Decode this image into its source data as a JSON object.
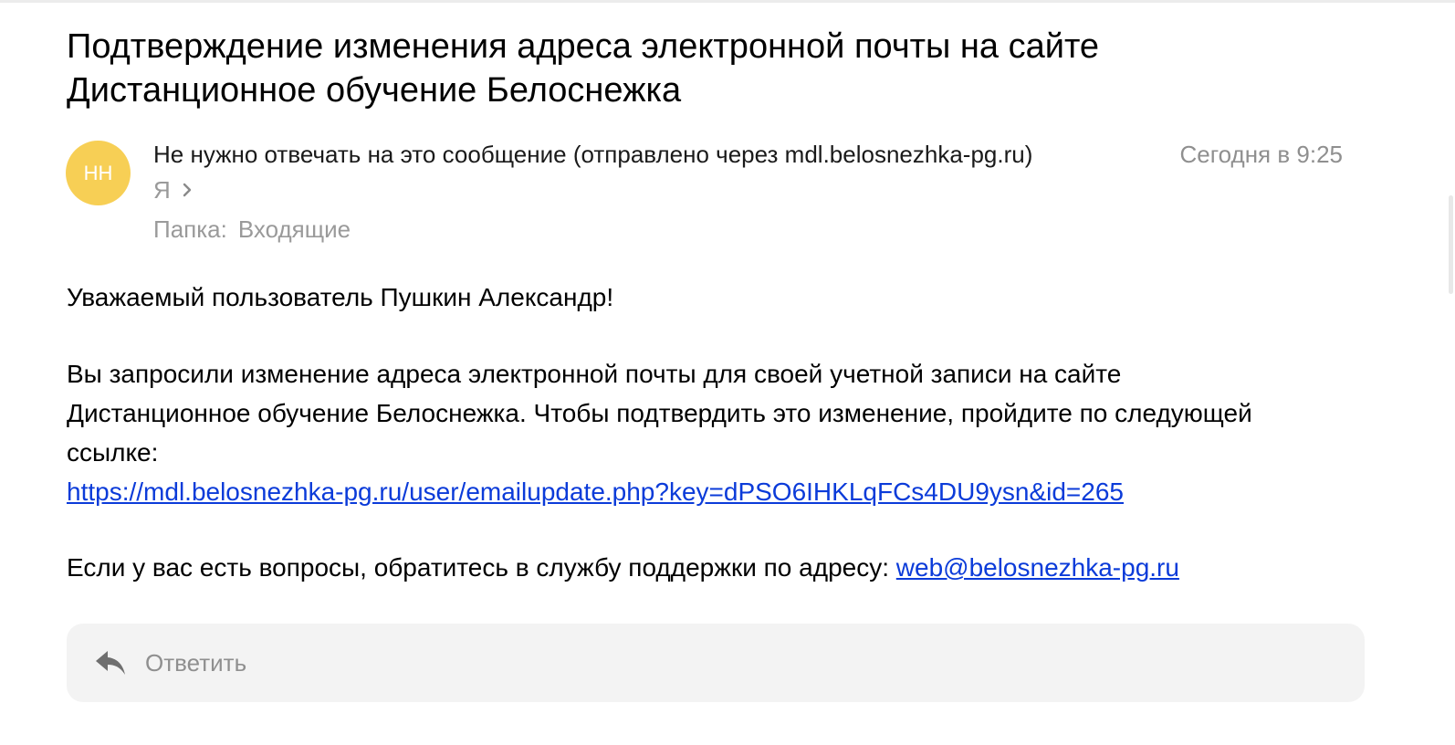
{
  "message": {
    "subject": "Подтверждение изменения адреса электронной почты на сайте Дистанционное обучение Белоснежка",
    "avatar_initials": "НН",
    "avatar_color": "#f7cf55",
    "sender": "Не нужно отвечать на это сообщение (отправлено через mdl.belosnezhka-pg.ru)",
    "date": "Сегодня в 9:25",
    "recipient": "Я",
    "folder_label": "Папка:",
    "folder_name": "Входящие"
  },
  "body": {
    "greeting": "Уважаемый пользователь Пушкин Александр!",
    "paragraph": "Вы запросили изменение адреса электронной почты для своей учетной записи на сайте Дистанционное обучение Белоснежка. Чтобы подтвердить это изменение, пройдите по следующей ссылке:",
    "confirm_link": "https://mdl.belosnezhka-pg.ru/user/emailupdate.php?key=dPSO6IHKLqFCs4DU9ysn&id=265",
    "support_text": "Если у вас есть вопросы, обратитесь в службу поддержки по адресу:",
    "support_email": "web@belosnezhka-pg.ru"
  },
  "reply": {
    "label": "Ответить",
    "icon": "reply-arrow-icon"
  },
  "colors": {
    "link": "#0b3bd9",
    "muted": "#8f8f8f",
    "reply_bar": "#f3f3f3"
  }
}
